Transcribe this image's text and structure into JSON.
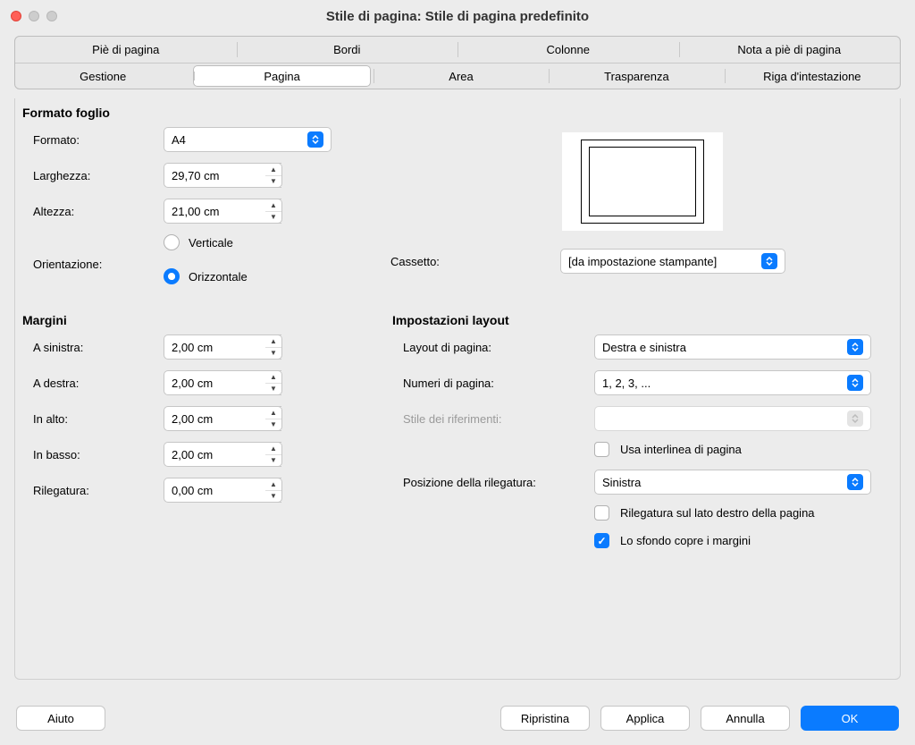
{
  "window": {
    "title": "Stile di pagina: Stile di pagina predefinito"
  },
  "tabs": {
    "row1": [
      "Piè di pagina",
      "Bordi",
      "Colonne",
      "Nota a piè di pagina"
    ],
    "row2": [
      "Gestione",
      "Pagina",
      "Area",
      "Trasparenza",
      "Riga d'intestazione"
    ],
    "active": "Pagina"
  },
  "paperFormat": {
    "section": "Formato foglio",
    "format_label": "Formato:",
    "format_value": "A4",
    "width_label": "Larghezza:",
    "width_value": "29,70 cm",
    "height_label": "Altezza:",
    "height_value": "21,00 cm",
    "orientation_label": "Orientazione:",
    "portrait": "Verticale",
    "landscape": "Orizzontale",
    "tray_label": "Cassetto:",
    "tray_value": "[da impostazione stampante]"
  },
  "margins": {
    "section": "Margini",
    "left_label": "A sinistra:",
    "left_value": "2,00 cm",
    "right_label": "A destra:",
    "right_value": "2,00 cm",
    "top_label": "In alto:",
    "top_value": "2,00 cm",
    "bottom_label": "In basso:",
    "bottom_value": "2,00 cm",
    "gutter_label": "Rilegatura:",
    "gutter_value": "0,00 cm"
  },
  "layoutSettings": {
    "section": "Impostazioni layout",
    "pagelayout_label": "Layout di pagina:",
    "pagelayout_value": "Destra e sinistra",
    "pagenum_label": "Numeri di pagina:",
    "pagenum_value": "1, 2, 3, ...",
    "refstyle_label": "Stile dei riferimenti:",
    "refstyle_value": "",
    "use_line_spacing": "Usa interlinea di pagina",
    "gutterpos_label": "Posizione della rilegatura:",
    "gutterpos_value": "Sinistra",
    "gutter_right": "Rilegatura sul lato destro della pagina",
    "background_covers": "Lo sfondo copre i margini"
  },
  "buttons": {
    "help": "Aiuto",
    "reset": "Ripristina",
    "apply": "Applica",
    "cancel": "Annulla",
    "ok": "OK"
  }
}
